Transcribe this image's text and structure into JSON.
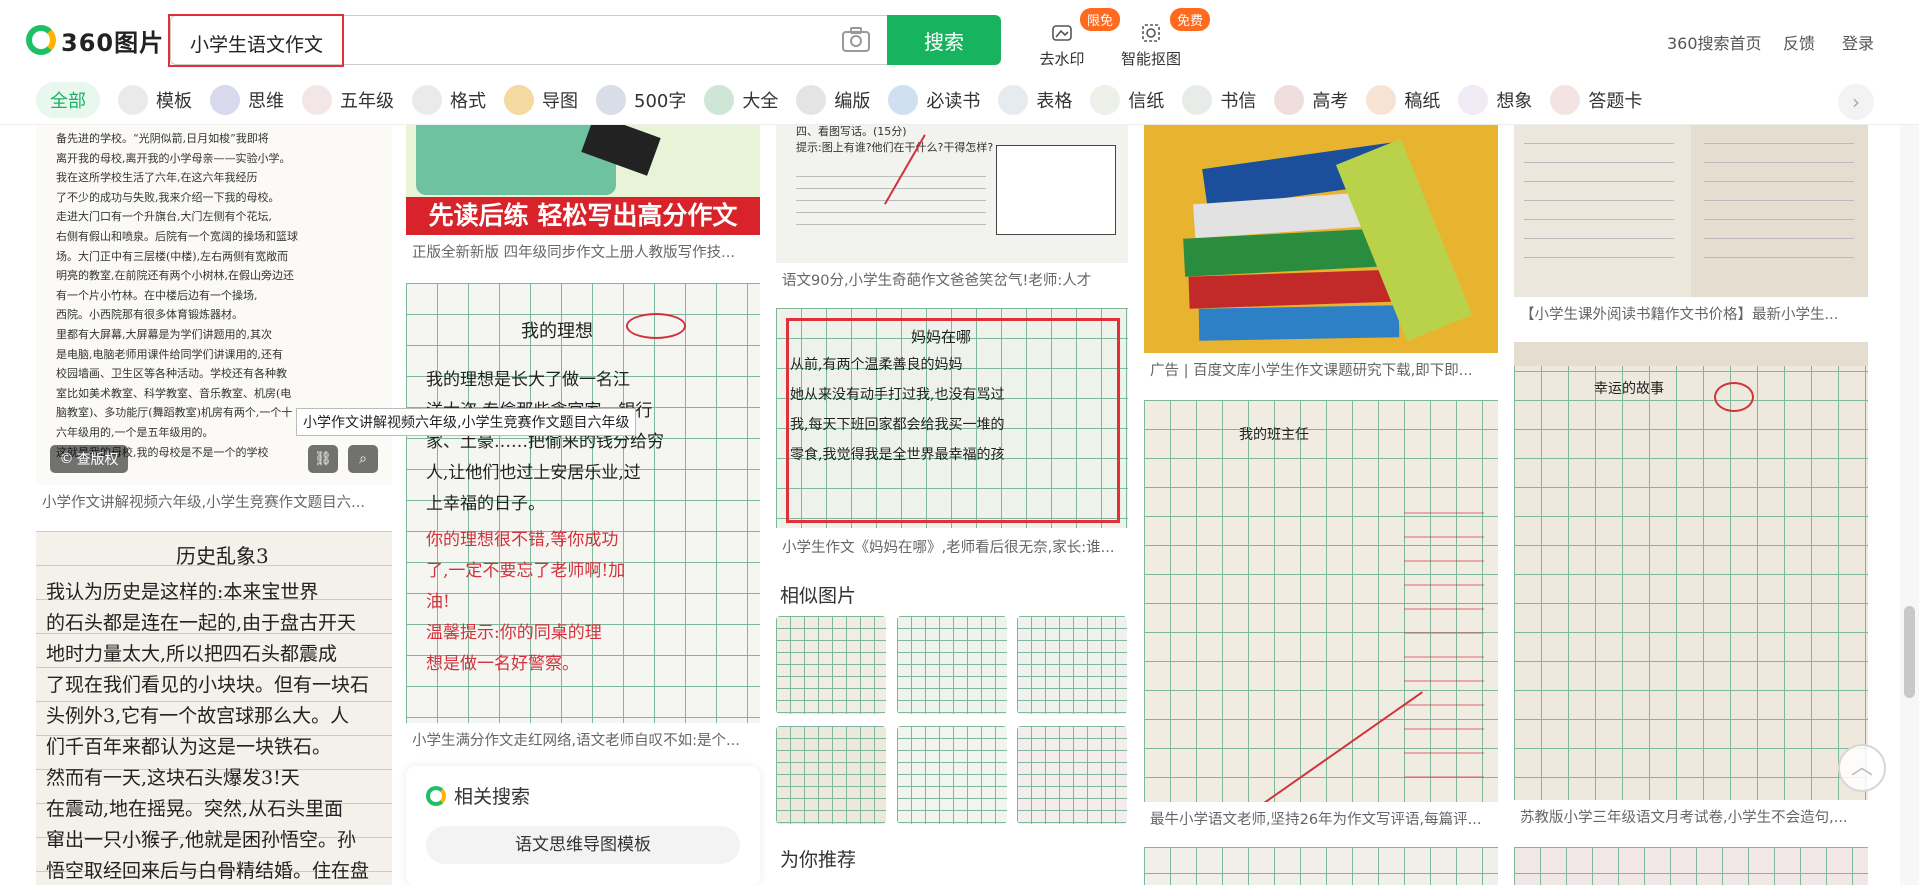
{
  "header": {
    "logo_text": "360图片",
    "search_value": "小学生语文作文",
    "search_button": "搜索",
    "tools": [
      {
        "label": "去水印",
        "badge": "限免",
        "icon": "watermark-icon"
      },
      {
        "label": "智能抠图",
        "badge": "免费",
        "icon": "cutout-icon"
      }
    ],
    "links": [
      "360搜索首页",
      "反馈",
      "登录"
    ],
    "brand_color": "#17b35e"
  },
  "tags": [
    "全部",
    "模板",
    "思维",
    "五年级",
    "格式",
    "导图",
    "500字",
    "大全",
    "编版",
    "必读书",
    "表格",
    "信纸",
    "书信",
    "高考",
    "稿纸",
    "想象",
    "答题卡"
  ],
  "col1": {
    "card1": {
      "caption": "小学作文讲解视频六年级,小学生竞赛作文题目六...",
      "copyright_btn": "查版权",
      "text_lines": [
        "备先进的学校。“光阴似箭,日月如梭”我即将",
        "离开我的母校,离开我的小学母亲——实验小学。",
        "我在这所学校生活了六年,在这六年我经历",
        "了不少的成功与失败,我来介绍一下我的母校。",
        "走进大门口有一个升旗台,大门左侧有个花坛,",
        "右侧有假山和喷泉。后院有一个宽阔的操场和篮球",
        "场。大门正中有三层楼(中楼),左右两侧有宽敞而",
        "明亮的教室,在前院还有两个小树林,在假山旁边还",
        "有一个片小竹林。在中楼后边有一个操场,",
        "西院。小西院那有很多体育锻炼器材。",
        "里都有大屏幕,大屏幕是为学们讲题用的,其次",
        "是电脑,电脑老师用课件给同学们讲课用的,还有",
        "校园墙画、卫生区等各种活动。学校还有各种教",
        "室比如美术教室、科学教室、音乐教室、机房(电",
        "脑教室)、多功能厅(舞蹈教室)机房有两个,一个十",
        "六年级用的,一个是五年级用的。",
        "这就是我的母校,我的母校是不是一个的学校"
      ]
    },
    "card2": {
      "title": "历史乱象3",
      "lines": [
        "我认为历史是这样的:本来宝世界",
        "的石头都是连在一起的,由于盘古开天",
        "地时力量太大,所以把四石头都震成",
        "了现在我们看见的小块块。但有一块石",
        "头例外3,它有一个故宫球那么大。人",
        "们千百年来都认为这是一块铁石。",
        "然而有一天,这块石头爆发3!天",
        "在震动,地在摇晃。突然,从石头里面",
        "窜出一只小猴子,他就是困孙悟空。孙",
        "悟空取经回来后与白骨精结婚。住在盘"
      ]
    }
  },
  "col2": {
    "card1": {
      "banner": "先读后练 轻松写出高分作文",
      "caption": "正版全新新版 四年级同步作文上册人教版写作技..."
    },
    "card2": {
      "title": "我的理想",
      "lines": [
        "我的理想是长大了做一名江",
        "洋大盗,专偷那些贪官家、银行",
        "家、土豪……把偷来的钱分给穷",
        "人,让他们也过上安居乐业,过",
        "上幸福的日子。"
      ],
      "comment": [
        "你的理想很不错,等你成功",
        "了,一定不要忘了老师啊!加",
        "油!",
        "温馨提示:你的同桌的理",
        "想是做一名好警察。"
      ],
      "caption": "小学生满分作文走红网络,语文老师自叹不如:是个..."
    },
    "related": {
      "title": "相关搜索",
      "item": "语文思维导图模板"
    },
    "tooltip": "小学作文讲解视频六年级,小学生竞赛作文题目六年级"
  },
  "col3": {
    "card1": {
      "header": "四、看图写话。(15分)",
      "prompt": "提示:图上有谁?他们在干什么?干得怎样?",
      "caption": "语文90分,小学生奇葩作文爸爸笑岔气!老师:人才"
    },
    "card2": {
      "title": "妈妈在哪",
      "lines": [
        "从前,有两个温柔善良的妈妈",
        "她从来没有动手打过我,也没有骂过",
        "我,每天下班回家都会给我买一堆的",
        "零食,我觉得我是全世界最幸福的孩"
      ],
      "caption": "小学生作文《妈妈在哪》,老师看后很无奈,家长:谁..."
    },
    "similar_title": "相似图片",
    "recommend_title": "为你推荐"
  },
  "col4": {
    "card1": {
      "caption_prefix": "广告",
      "caption": "百度文库小学生作文课题研究下载,即下即..."
    },
    "card2": {
      "title": "我的班主任",
      "caption": "最牛小学语文老师,坚持26年为作文写评语,每篇评..."
    }
  },
  "col5": {
    "card1": {
      "caption": "【小学生课外阅读书籍作文书价格】最新小学生..."
    },
    "card2": {
      "title": "幸运的故事",
      "caption": "苏教版小学三年级语文月考试卷,小学生不会造句,..."
    }
  }
}
